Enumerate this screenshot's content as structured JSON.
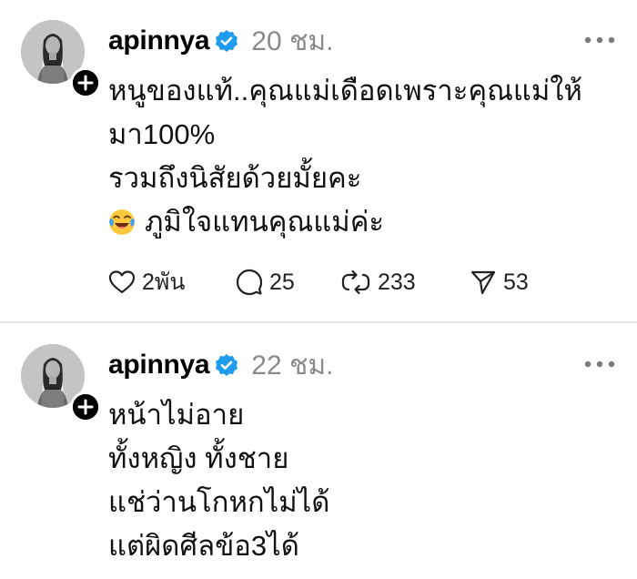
{
  "colors": {
    "verified": "#1f9bf0",
    "time": "#8a8a8a",
    "divider": "#e4e4e4"
  },
  "posts": [
    {
      "username": "apinnya",
      "time": "20 ชม.",
      "lines": [
        "หนูของแท้..คุณแม่เดือดเพราะคุณแม่ให้",
        "มา100%",
        "รวมถึงนิสัยด้วยมั้ยคะ",
        "ภูมิใจแทนคุณแม่ค่ะ"
      ],
      "emoji": "face-with-tears-of-joy",
      "actions": {
        "likes": "2พัน",
        "replies": "25",
        "reposts": "233",
        "shares": "53"
      }
    },
    {
      "username": "apinnya",
      "time": "22 ชม.",
      "lines": [
        "หน้าไม่อาย",
        "ทั้งหญิง ทั้งชาย",
        "แช่ว่านโกหกไม่ได้",
        "แต่ผิดศีลข้อ3ได้"
      ]
    }
  ]
}
